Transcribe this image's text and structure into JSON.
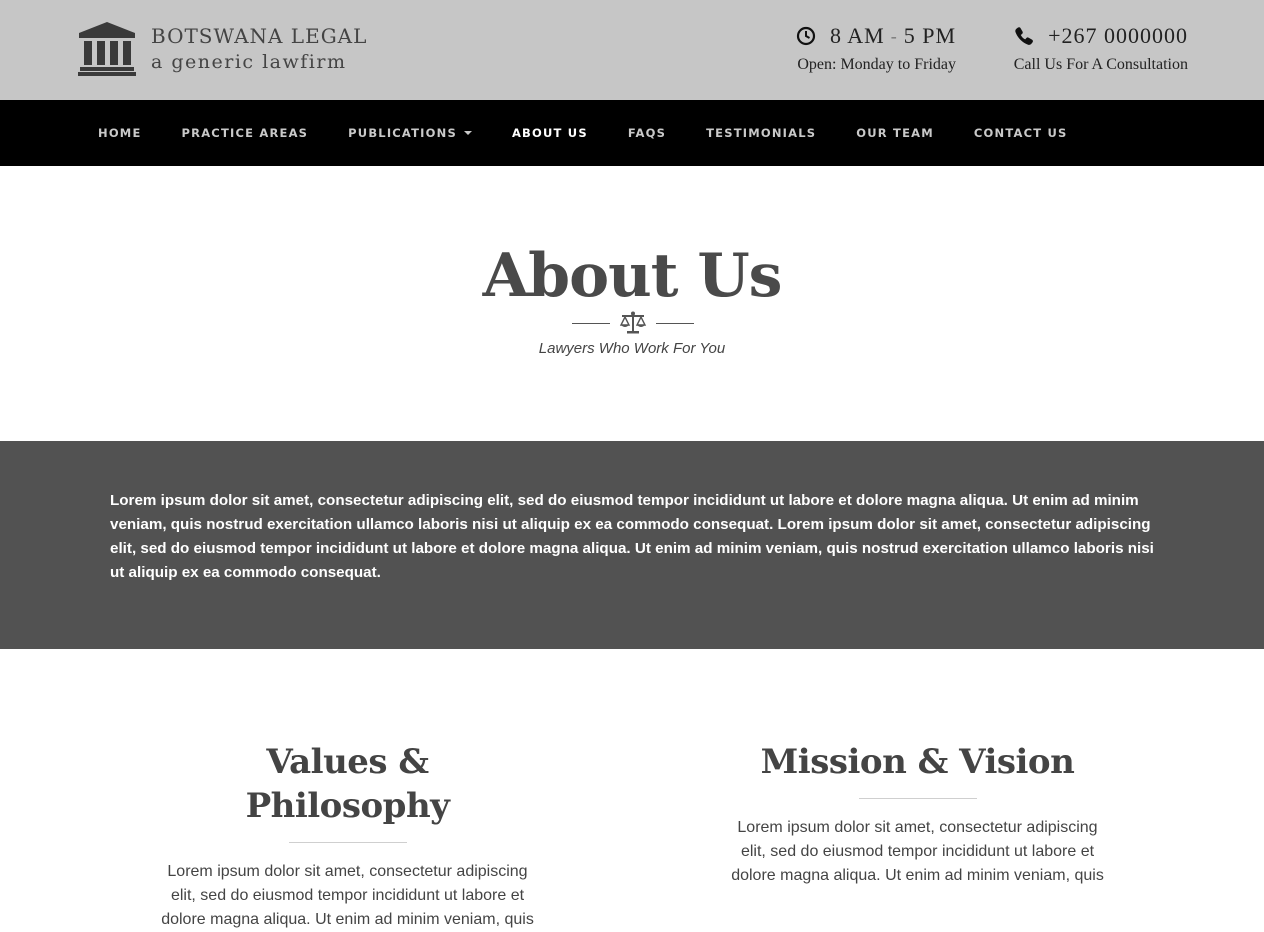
{
  "header": {
    "brand": {
      "icon": "courthouse-icon",
      "title": "BOTSWANA LEGAL",
      "subtitle": "a generic lawfirm"
    },
    "hours": {
      "icon": "clock-icon",
      "open": "8 AM",
      "separator": "-",
      "close": "5 PM",
      "days": "Open: Monday to Friday"
    },
    "phone": {
      "icon": "phone-icon",
      "number": "+267 0000000",
      "cta": "Call Us For A Consultation"
    }
  },
  "nav": {
    "items": [
      {
        "label": "HOME"
      },
      {
        "label": "PRACTICE AREAS"
      },
      {
        "label": "PUBLICATIONS"
      },
      {
        "label": "ABOUT US"
      },
      {
        "label": "FAQS"
      },
      {
        "label": "TESTIMONIALS"
      },
      {
        "label": "OUR TEAM"
      },
      {
        "label": "CONTACT US"
      }
    ],
    "active": "ABOUT US"
  },
  "hero": {
    "title": "About Us",
    "divider_icon": "scales-icon",
    "subtitle": "Lawyers Who Work For You"
  },
  "band": {
    "text": "Lorem ipsum dolor sit amet, consectetur adipiscing elit, sed do eiusmod tempor incididunt ut labore et dolore magna aliqua. Ut enim ad minim veniam, quis nostrud exercitation ullamco laboris nisi ut aliquip ex ea commodo consequat. Lorem ipsum dolor sit amet, consectetur adipiscing elit, sed do eiusmod tempor incididunt ut labore et dolore magna aliqua. Ut enim ad minim veniam, quis nostrud exercitation ullamco laboris nisi ut aliquip ex ea commodo consequat."
  },
  "columns": [
    {
      "title": "Values & Philosophy",
      "text": "Lorem ipsum dolor sit amet, consectetur adipiscing elit, sed do eiusmod tempor incididunt ut labore et dolore magna aliqua. Ut enim ad minim veniam, quis"
    },
    {
      "title": "Mission & Vision",
      "text": "Lorem ipsum dolor sit amet, consectetur adipiscing elit, sed do eiusmod tempor incididunt ut labore et dolore magna aliqua. Ut enim ad minim veniam, quis"
    }
  ],
  "colors": {
    "header_bg": "#c6c6c6",
    "nav_bg": "#000000",
    "band_bg": "#525252",
    "text": "#444444"
  }
}
